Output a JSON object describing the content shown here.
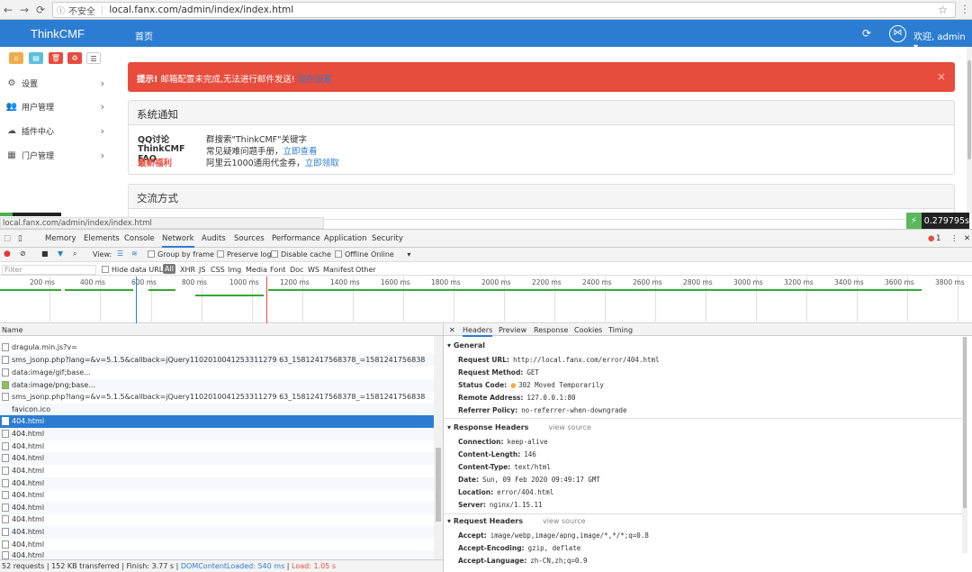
{
  "browser": {
    "insecure_label": "不安全",
    "url": "local.fanx.com/admin/index/index.html",
    "status_url": "local.fanx.com/admin/index/index.html"
  },
  "app": {
    "brand": "ThinkCMF",
    "home_link": "首页",
    "welcome": "欢迎, admin ▾",
    "sidebar": [
      {
        "label": "设置",
        "icon": "gears-icon"
      },
      {
        "label": "用户管理",
        "icon": "users-icon"
      },
      {
        "label": "插件中心",
        "icon": "cloud-icon"
      },
      {
        "label": "门户管理",
        "icon": "grid-icon"
      }
    ],
    "alert": {
      "prefix": "提示!",
      "message": " 邮箱配置未完成,无法进行邮件发送! ",
      "link": "现在设置"
    },
    "panel_notice": {
      "title": "系统通知",
      "rows": [
        {
          "key": "QQ讨论",
          "value": "群搜索\"ThinkCMF\"关键字",
          "link": ""
        },
        {
          "key": "ThinkCMF FAQ",
          "value": "常见疑难问题手册，",
          "link": "立即查看"
        },
        {
          "key": "最新福利",
          "value": "阿里云1000通用代金券，",
          "link": "立即领取"
        }
      ]
    },
    "panel_contact": {
      "title": "交流方式"
    },
    "timer": "0.279795s"
  },
  "devtools": {
    "tabs": [
      "Memory",
      "Elements",
      "Console",
      "Network",
      "Audits",
      "Sources",
      "Performance",
      "Application",
      "Security"
    ],
    "active_tab": "Network",
    "error_count": "1",
    "toolbar": {
      "view_label": "View:",
      "group_by_frame": "Group by frame",
      "preserve_log": "Preserve log",
      "disable_cache": "Disable cache",
      "offline": "Offline",
      "throttle": "Online"
    },
    "filter": {
      "placeholder": "Filter",
      "hide_data_urls": "Hide data URLs",
      "types": [
        "All",
        "XHR",
        "JS",
        "CSS",
        "Img",
        "Media",
        "Font",
        "Doc",
        "WS",
        "Manifest",
        "Other"
      ]
    },
    "timeline_ticks": [
      "200 ms",
      "400 ms",
      "600 ms",
      "800 ms",
      "1000 ms",
      "1200 ms",
      "1400 ms",
      "1600 ms",
      "1800 ms",
      "2000 ms",
      "2200 ms",
      "2400 ms",
      "2600 ms",
      "2800 ms",
      "3000 ms",
      "3200 ms",
      "3400 ms",
      "3600 ms",
      "3800 ms"
    ],
    "list_header": "Name",
    "requests": [
      "dragula.min.js?v=",
      "sms_jsonp.php?lang=&v=5.1.5&callback=jQuery1102010041253311279 63_15812417568378_=1581241756838",
      "data:image/gif;base...",
      "data:image/png;base...",
      "sms_jsonp.php?lang=&v=5.1.5&callback=jQuery1102010041253311279 63_15812417568378_=1581241756838",
      "favicon.ico",
      "404.html",
      "404.html",
      "404.html",
      "404.html",
      "404.html",
      "404.html",
      "404.html",
      "404.html",
      "404.html",
      "404.html",
      "404.html",
      "404.html"
    ],
    "selected_index": 6,
    "summary": {
      "requests": "52 requests",
      "transferred": "152 KB transferred",
      "finish": "Finish: 3.77 s",
      "dcl": "DOMContentLoaded: 540 ms",
      "load": "Load: 1.05 s"
    },
    "detail_tabs": [
      "Headers",
      "Preview",
      "Response",
      "Cookies",
      "Timing"
    ],
    "general": {
      "title": "General",
      "rows": [
        {
          "k": "Request URL:",
          "v": "http://local.fanx.com/error/404.html"
        },
        {
          "k": "Request Method:",
          "v": "GET"
        },
        {
          "k": "Status Code:",
          "v": "302 Moved Temporarily"
        },
        {
          "k": "Remote Address:",
          "v": "127.0.0.1:80"
        },
        {
          "k": "Referrer Policy:",
          "v": "no-referrer-when-downgrade"
        }
      ]
    },
    "response_headers": {
      "title": "Response Headers",
      "view_source": "view source",
      "rows": [
        {
          "k": "Connection:",
          "v": "keep-alive"
        },
        {
          "k": "Content-Length:",
          "v": "146"
        },
        {
          "k": "Content-Type:",
          "v": "text/html"
        },
        {
          "k": "Date:",
          "v": "Sun, 09 Feb 2020 09:49:17 GMT"
        },
        {
          "k": "Location:",
          "v": "error/404.html"
        },
        {
          "k": "Server:",
          "v": "nginx/1.15.11"
        }
      ]
    },
    "request_headers": {
      "title": "Request Headers",
      "view_source": "view source",
      "rows": [
        {
          "k": "Accept:",
          "v": "image/webp,image/apng,image/*,*/*;q=0.8"
        },
        {
          "k": "Accept-Encoding:",
          "v": "gzip, deflate"
        },
        {
          "k": "Accept-Language:",
          "v": "zh-CN,zh;q=0.9"
        }
      ]
    },
    "colors": {
      "accent": "#2c7dd1",
      "alert": "#e74c3c",
      "status_dot": "#f0ad4e"
    }
  }
}
